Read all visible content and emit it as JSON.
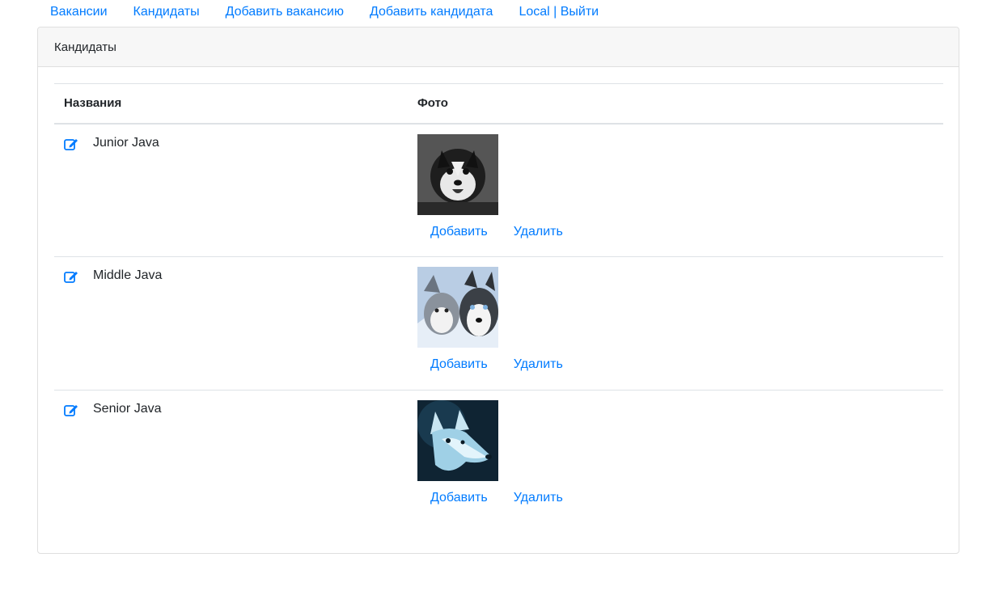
{
  "nav": {
    "items": [
      {
        "label": "Вакансии"
      },
      {
        "label": "Кандидаты"
      },
      {
        "label": "Добавить вакансию"
      },
      {
        "label": "Добавить кандидата"
      },
      {
        "label": "Local | Выйти"
      }
    ]
  },
  "card": {
    "title": "Кандидаты"
  },
  "table": {
    "headers": {
      "name": "Названия",
      "photo": "Фото"
    },
    "rows": [
      {
        "name": "Junior Java",
        "photo_icon": "husky-puppy-photo",
        "add_label": "Добавить",
        "delete_label": "Удалить"
      },
      {
        "name": "Middle Java",
        "photo_icon": "two-huskies-photo",
        "add_label": "Добавить",
        "delete_label": "Удалить"
      },
      {
        "name": "Senior Java",
        "photo_icon": "blue-wolf-photo",
        "add_label": "Добавить",
        "delete_label": "Удалить"
      }
    ]
  },
  "colors": {
    "link": "#007bff",
    "border": "#dee2e6",
    "header_bg": "#f7f7f7"
  }
}
